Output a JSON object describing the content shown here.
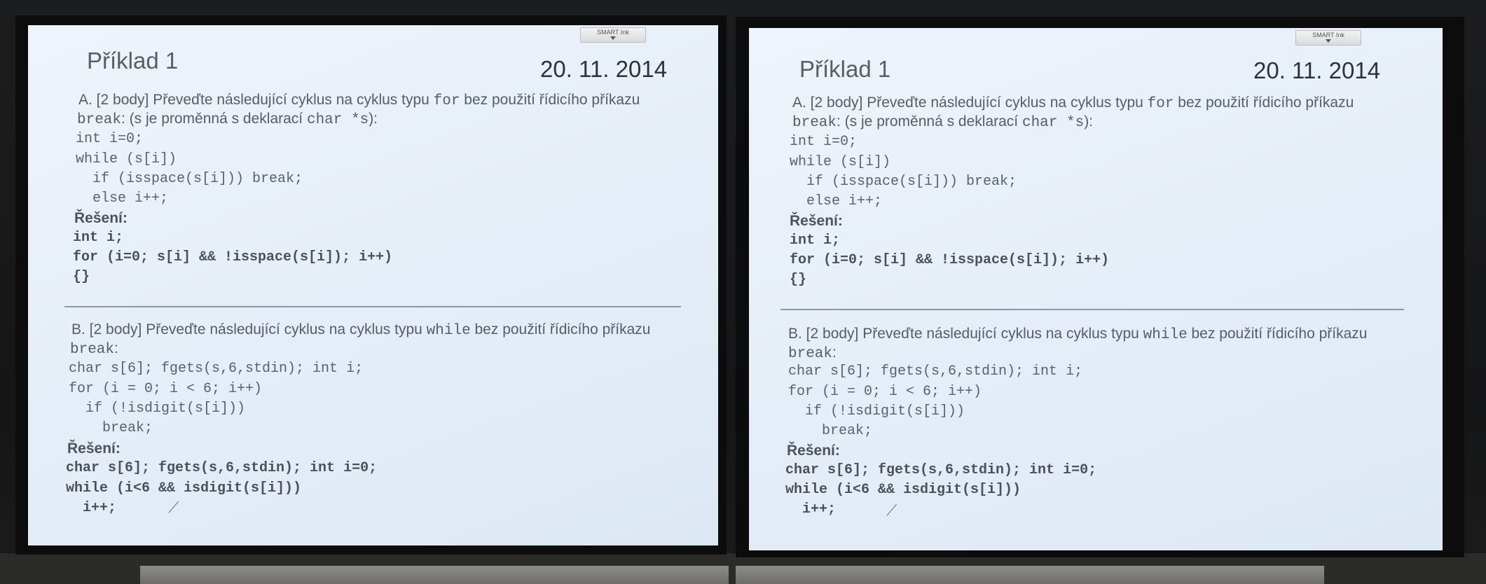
{
  "slide": {
    "smart_badge": "SMART Ink",
    "title": "Příklad 1",
    "date": "20. 11. 2014",
    "a_line1_prefix": "A. [2 body] Převeďte následující cyklus na cyklus typu ",
    "a_line1_kw": "for",
    "a_line1_suffix": " bez použití řídicího příkazu",
    "a_line2_kw": "break",
    "a_line2_mid": ": (s je proměnná s deklarací ",
    "a_line2_code": "char *s",
    "a_line2_end": "):",
    "a_code": [
      "int i=0;",
      "while (s[i])",
      "  if (isspace(s[i])) break;",
      "  else i++;"
    ],
    "a_reseni": "Řešení:",
    "a_solution": [
      "int i;",
      "for (i=0; s[i] && !isspace(s[i]); i++)",
      "{}"
    ],
    "b_line1_prefix": "B. [2 body] Převeďte následující cyklus na cyklus typu ",
    "b_line1_kw": "while",
    "b_line1_suffix": " bez použití řídicího příkazu",
    "b_line2_kw": "break",
    "b_line2_end": ":",
    "b_code": [
      "char s[6]; fgets(s,6,stdin); int i;",
      "for (i = 0; i < 6; i++)",
      "  if (!isdigit(s[i]))",
      "    break;"
    ],
    "b_reseni": "Řešení:",
    "b_solution": [
      "char s[6]; fgets(s,6,stdin); int i=0;",
      "while (i<6 && isdigit(s[i]))",
      "  i++;"
    ]
  }
}
